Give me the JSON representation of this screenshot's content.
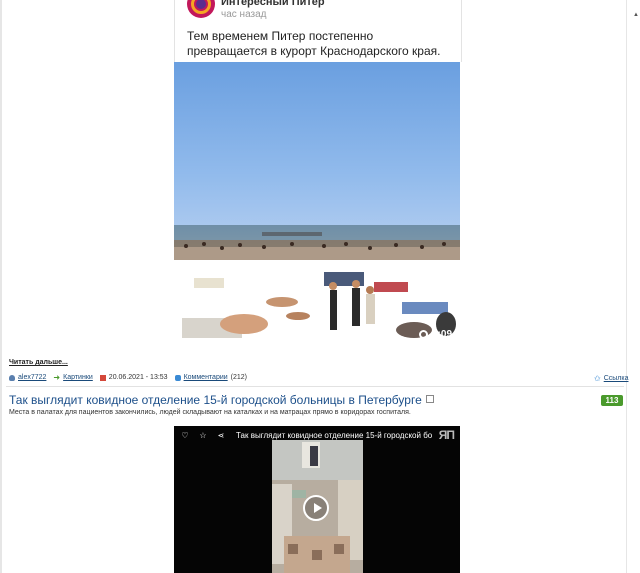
{
  "post": {
    "author": "Интересный Питер",
    "time": "час назад",
    "text": "Тем временем Питер постепенно превращается в курорт Краснодарского края.",
    "video_duration": "0:09"
  },
  "article1": {
    "read_more": "Читать дальше...",
    "author": "alex7722",
    "category": "Картинки",
    "date": "20.06.2021 - 13:53",
    "comments_label": "Комментарии",
    "comments_count": "(212)",
    "link_label": "Ссылка"
  },
  "article2": {
    "title": "Так выглядит ковидное отделение 15-й городской больницы в Петербурге",
    "rating": "113",
    "description": "Места в палатах для пациентов закончились, людей складывают на каталках и на матрацах прямо в коридорах госпиталя.",
    "video_title": "Так выглядит ковидное отделение 15-й городской боль..."
  },
  "colors": {
    "link": "#1c4f8a",
    "badge": "#4a9a2c"
  },
  "icons": [
    "user-icon",
    "category-arrow-icon",
    "calendar-icon",
    "comments-icon",
    "link-star-icon",
    "heart-icon",
    "star-icon",
    "share-icon",
    "popout-icon",
    "play-icon"
  ]
}
